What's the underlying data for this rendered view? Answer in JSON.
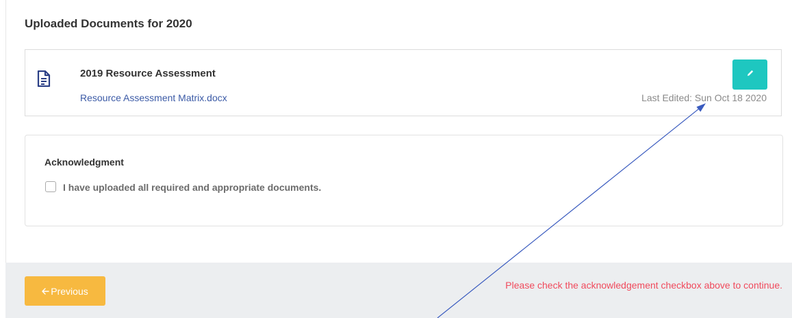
{
  "section": {
    "title": "Uploaded Documents for 2020"
  },
  "document": {
    "icon": "document-icon",
    "title": "2019 Resource Assessment",
    "file_name": "Resource Assessment Matrix.docx",
    "last_edited": "Last Edited: Sun Oct 18 2020",
    "edit_icon": "pencil-icon"
  },
  "acknowledgment": {
    "title": "Acknowledgment",
    "checkbox_label": "I have uploaded all required and appropriate documents.",
    "checked": false
  },
  "footer": {
    "previous_icon": "arrow-left-icon",
    "previous_label": "Previous",
    "warning": "Please check the acknowledgement checkbox above to continue."
  },
  "colors": {
    "accent_teal": "#1ec7c0",
    "previous_orange": "#f7b940",
    "warning_red": "#f04a5c",
    "link_blue": "#3b5aa6",
    "annotation_arrow": "#3a5bbf"
  }
}
